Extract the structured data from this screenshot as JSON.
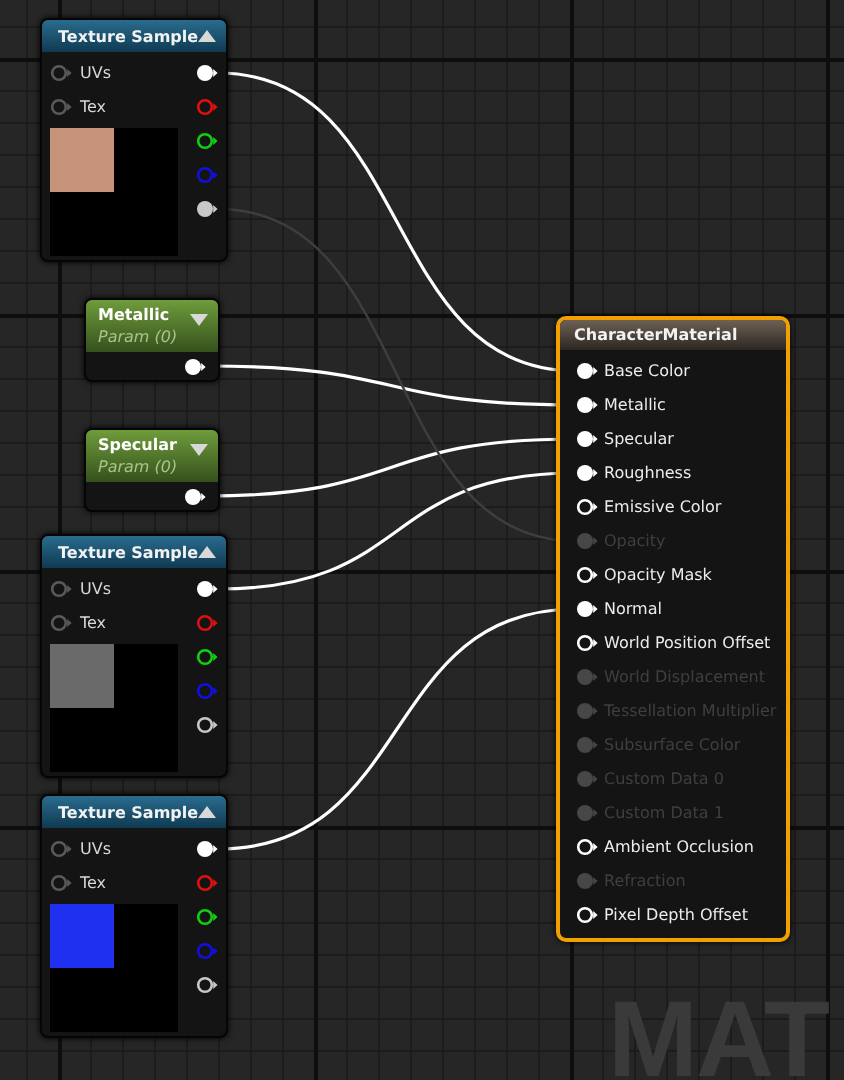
{
  "graph": {
    "nodes": [
      {
        "kind": "texture",
        "title": "Texture Sample",
        "inputs": [
          {
            "label": "UVs",
            "connected": false
          },
          {
            "label": "Tex",
            "connected": false
          }
        ],
        "outputs": [
          {
            "color": "#ffffff",
            "connected": true,
            "wire": {
              "dimmed": false
            }
          },
          {
            "color": "#e01010",
            "connected": false
          },
          {
            "color": "#10d010",
            "connected": false
          },
          {
            "color": "#1010e0",
            "connected": false
          },
          {
            "color": "#c8c8c8",
            "connected": true,
            "wire": {
              "dimmed": true
            }
          }
        ],
        "preview": {
          "color": "#c4937a"
        }
      },
      {
        "kind": "param",
        "title": "Metallic",
        "subtitle": "Param (0)",
        "outputs": [
          {
            "color": "#ffffff",
            "connected": true,
            "wire": {
              "dimmed": false
            }
          }
        ]
      },
      {
        "kind": "param",
        "title": "Specular",
        "subtitle": "Param (0)",
        "outputs": [
          {
            "color": "#ffffff",
            "connected": true,
            "wire": {
              "dimmed": false
            }
          }
        ]
      },
      {
        "kind": "texture",
        "title": "Texture Sample",
        "inputs": [
          {
            "label": "UVs",
            "connected": false
          },
          {
            "label": "Tex",
            "connected": false
          }
        ],
        "outputs": [
          {
            "color": "#ffffff",
            "connected": true,
            "wire": {
              "dimmed": false
            }
          },
          {
            "color": "#e01010",
            "connected": false
          },
          {
            "color": "#10d010",
            "connected": false
          },
          {
            "color": "#1010e0",
            "connected": false
          },
          {
            "color": "#c8c8c8",
            "connected": false
          }
        ],
        "preview": {
          "color": "#6a6a6a"
        }
      },
      {
        "kind": "texture",
        "title": "Texture Sample",
        "inputs": [
          {
            "label": "UVs",
            "connected": false
          },
          {
            "label": "Tex",
            "connected": false
          }
        ],
        "outputs": [
          {
            "color": "#ffffff",
            "connected": true,
            "wire": {
              "dimmed": false
            }
          },
          {
            "color": "#e01010",
            "connected": false
          },
          {
            "color": "#10d010",
            "connected": false
          },
          {
            "color": "#1010e0",
            "connected": false
          },
          {
            "color": "#c8c8c8",
            "connected": false
          }
        ],
        "preview": {
          "color": "#2030f0"
        }
      }
    ],
    "material": {
      "title": "CharacterMaterial",
      "selected": true,
      "inputs": [
        {
          "label": "Base Color",
          "connected": true,
          "disabled": false
        },
        {
          "label": "Metallic",
          "connected": true,
          "disabled": false
        },
        {
          "label": "Specular",
          "connected": true,
          "disabled": false
        },
        {
          "label": "Roughness",
          "connected": true,
          "disabled": false
        },
        {
          "label": "Emissive Color",
          "connected": false,
          "disabled": false
        },
        {
          "label": "Opacity",
          "connected": true,
          "disabled": true
        },
        {
          "label": "Opacity Mask",
          "connected": false,
          "disabled": false
        },
        {
          "label": "Normal",
          "connected": true,
          "disabled": false
        },
        {
          "label": "World Position Offset",
          "connected": false,
          "disabled": false
        },
        {
          "label": "World Displacement",
          "connected": false,
          "disabled": true
        },
        {
          "label": "Tessellation Multiplier",
          "connected": false,
          "disabled": true
        },
        {
          "label": "Subsurface Color",
          "connected": false,
          "disabled": true
        },
        {
          "label": "Custom Data 0",
          "connected": false,
          "disabled": true
        },
        {
          "label": "Custom Data 1",
          "connected": false,
          "disabled": true
        },
        {
          "label": "Ambient Occlusion",
          "connected": false,
          "disabled": false
        },
        {
          "label": "Refraction",
          "connected": false,
          "disabled": true
        },
        {
          "label": "Pixel Depth Offset",
          "connected": false,
          "disabled": false
        }
      ]
    },
    "watermark": "MAT"
  }
}
